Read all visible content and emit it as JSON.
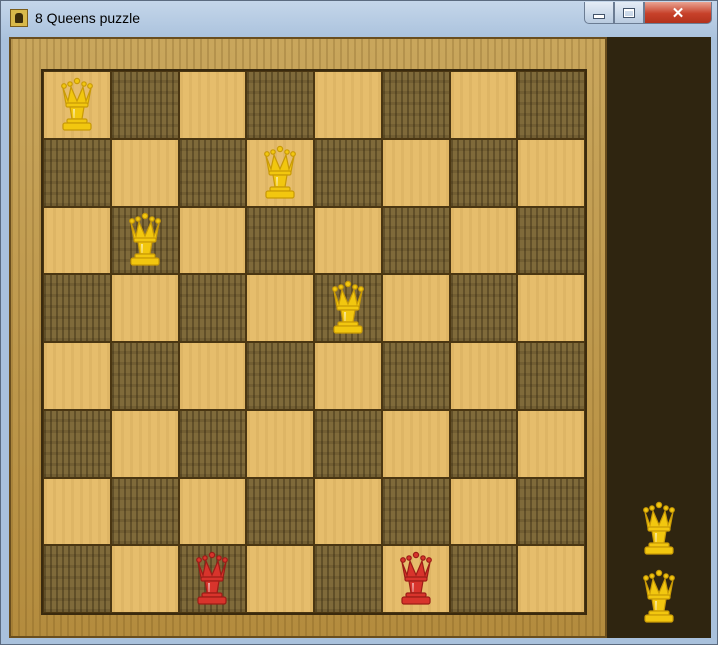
{
  "window": {
    "title": "8 Queens puzzle",
    "close_glyph": "✕"
  },
  "board": {
    "size": 8,
    "light_color": "#e6bd6c",
    "dark_color": "#7f6a3a",
    "queens": [
      {
        "row": 0,
        "col": 0,
        "color": "gold"
      },
      {
        "row": 1,
        "col": 3,
        "color": "gold"
      },
      {
        "row": 2,
        "col": 1,
        "color": "gold"
      },
      {
        "row": 3,
        "col": 4,
        "color": "gold"
      },
      {
        "row": 7,
        "col": 2,
        "color": "red"
      },
      {
        "row": 7,
        "col": 5,
        "color": "red"
      }
    ]
  },
  "reserve": {
    "queens": [
      {
        "color": "gold"
      },
      {
        "color": "gold"
      }
    ]
  },
  "colors": {
    "gold_fill": "#f2c70f",
    "gold_shade": "#c99a06",
    "red_fill": "#d8342c",
    "red_shade": "#9c1d17"
  }
}
